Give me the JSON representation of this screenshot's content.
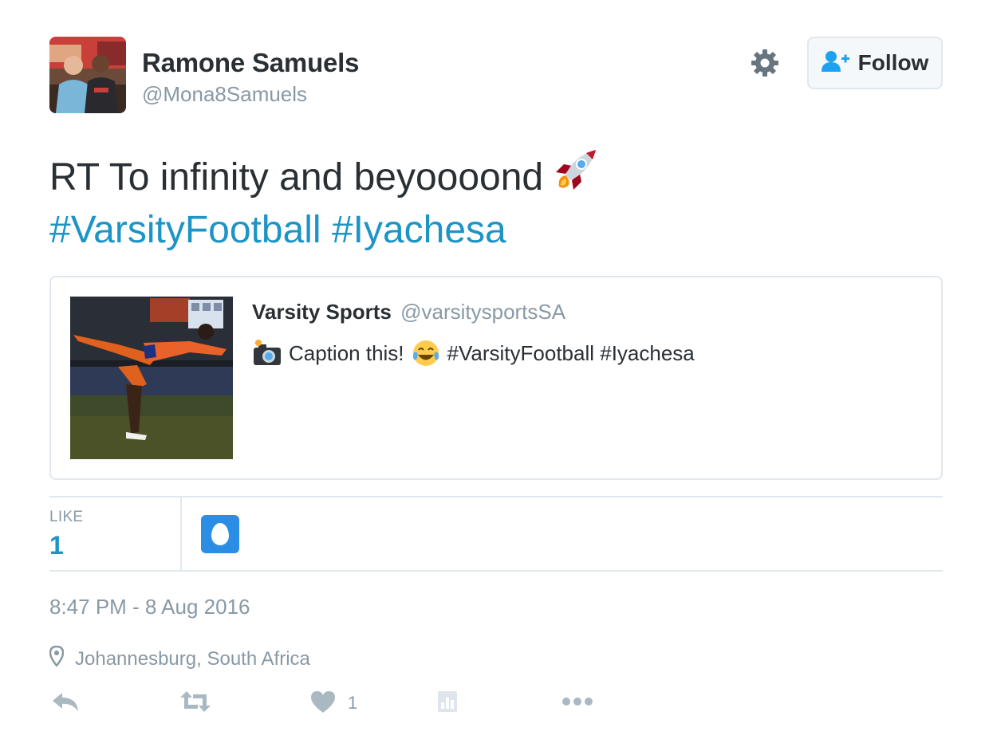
{
  "author": {
    "name": "Ramone Samuels",
    "handle": "@Mona8Samuels"
  },
  "header": {
    "follow_label": "Follow"
  },
  "tweet": {
    "text": "RT To infinity and beyoooond",
    "hashtags": [
      "#VarsityFootball",
      "#Iyachesa"
    ]
  },
  "quoted_tweet": {
    "name": "Varsity Sports",
    "handle": "@varsitysportsSA",
    "text": "Caption this!",
    "hashtags": "#VarsityFootball #Iyachesa"
  },
  "stats": {
    "like_label": "LIKE",
    "like_count": "1"
  },
  "meta": {
    "timestamp": "8:47 PM - 8 Aug 2016",
    "location": "Johannesburg, South Africa"
  },
  "actions": {
    "like_count": "1"
  },
  "colors": {
    "link": "#1c94c6",
    "muted": "#8899a6",
    "border": "#e1e8ed",
    "follow_icon": "#1da1f2"
  },
  "icons": [
    "gear-icon",
    "follow-person-icon",
    "rocket-emoji",
    "camera-flash-emoji",
    "tears-of-joy-emoji",
    "egg-avatar-icon",
    "location-pin-icon",
    "reply-icon",
    "retweet-icon",
    "heart-icon",
    "analytics-icon",
    "more-icon"
  ]
}
